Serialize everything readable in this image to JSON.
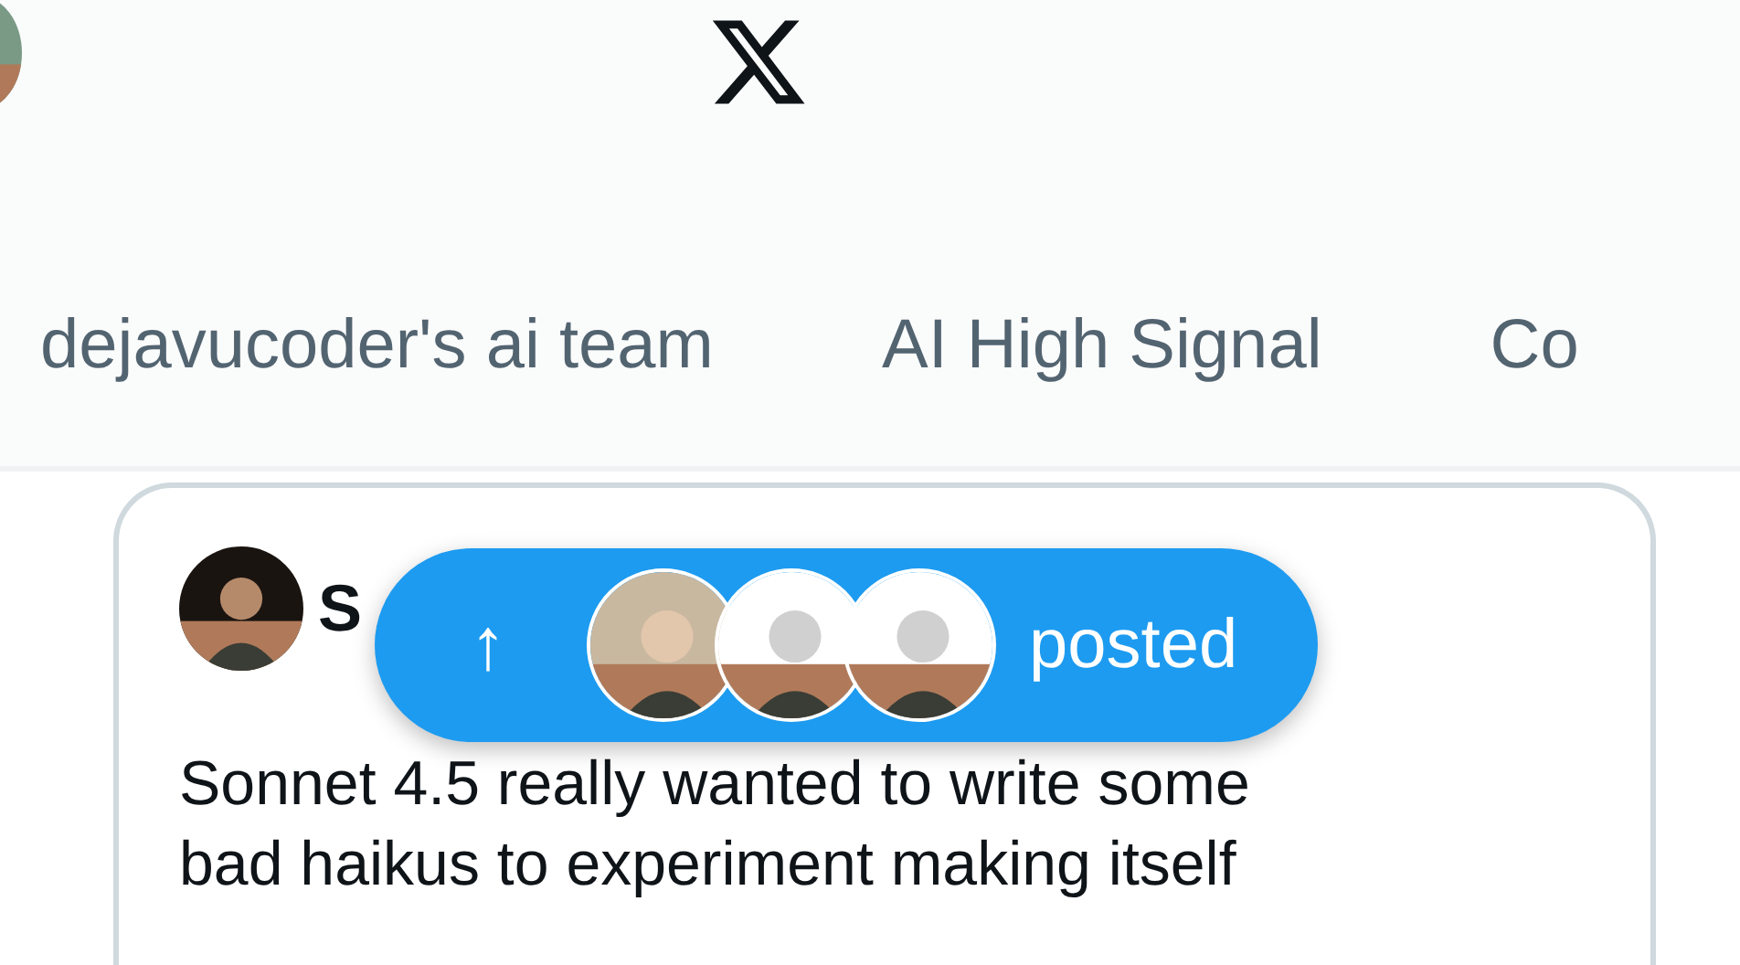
{
  "tabs": [
    {
      "label": "dejavucoder's ai team",
      "selected": false
    },
    {
      "label": "AI High Signal",
      "selected": false
    },
    {
      "label": "Co",
      "selected": false
    }
  ],
  "post": {
    "author": "S",
    "text": "Sonnet 4.5 really wanted to write some bad haikus to experiment making itself"
  },
  "new_posts_pill": {
    "arrow": "↑",
    "label": "posted"
  }
}
